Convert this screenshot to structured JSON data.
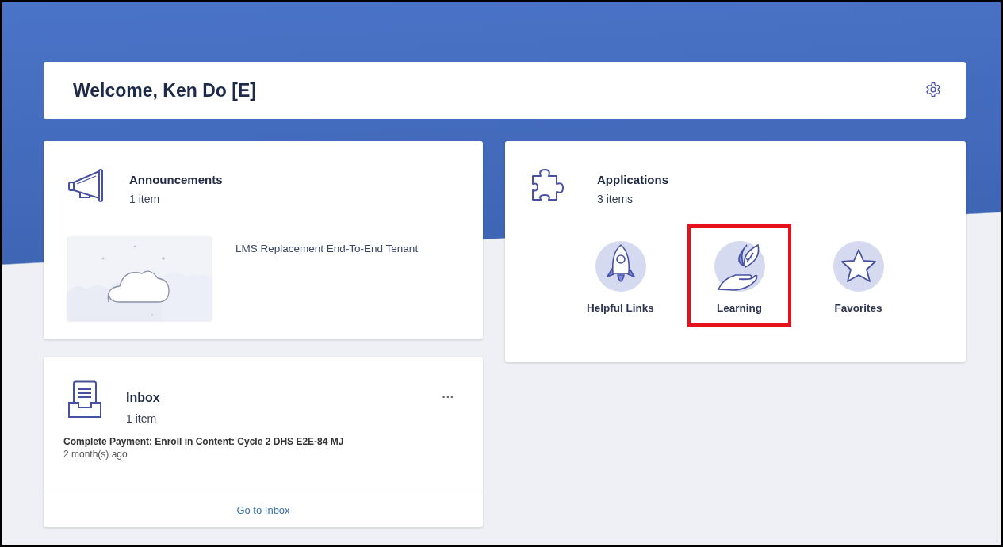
{
  "welcome": {
    "title": "Welcome, Ken Do [E]"
  },
  "announcements": {
    "title": "Announcements",
    "count": "1 item",
    "items": [
      {
        "kind": "picture",
        "title": "LMS Replacement End-To-End Tenant"
      }
    ]
  },
  "inbox": {
    "title": "Inbox",
    "count": "1 item",
    "more": "...",
    "message": "Complete Payment: Enroll in Content: Cycle 2 DHS E2E-84 MJ",
    "time": "2 month(s) ago",
    "footer_link": "Go to Inbox"
  },
  "applications": {
    "title": "Applications",
    "count": "3 items",
    "apps": [
      {
        "kind": "rocket",
        "label": "Helpful Links",
        "highlighted": false
      },
      {
        "kind": "leaf",
        "label": "Learning",
        "highlighted": true
      },
      {
        "kind": "star",
        "label": "Favorites",
        "highlighted": false
      }
    ]
  }
}
